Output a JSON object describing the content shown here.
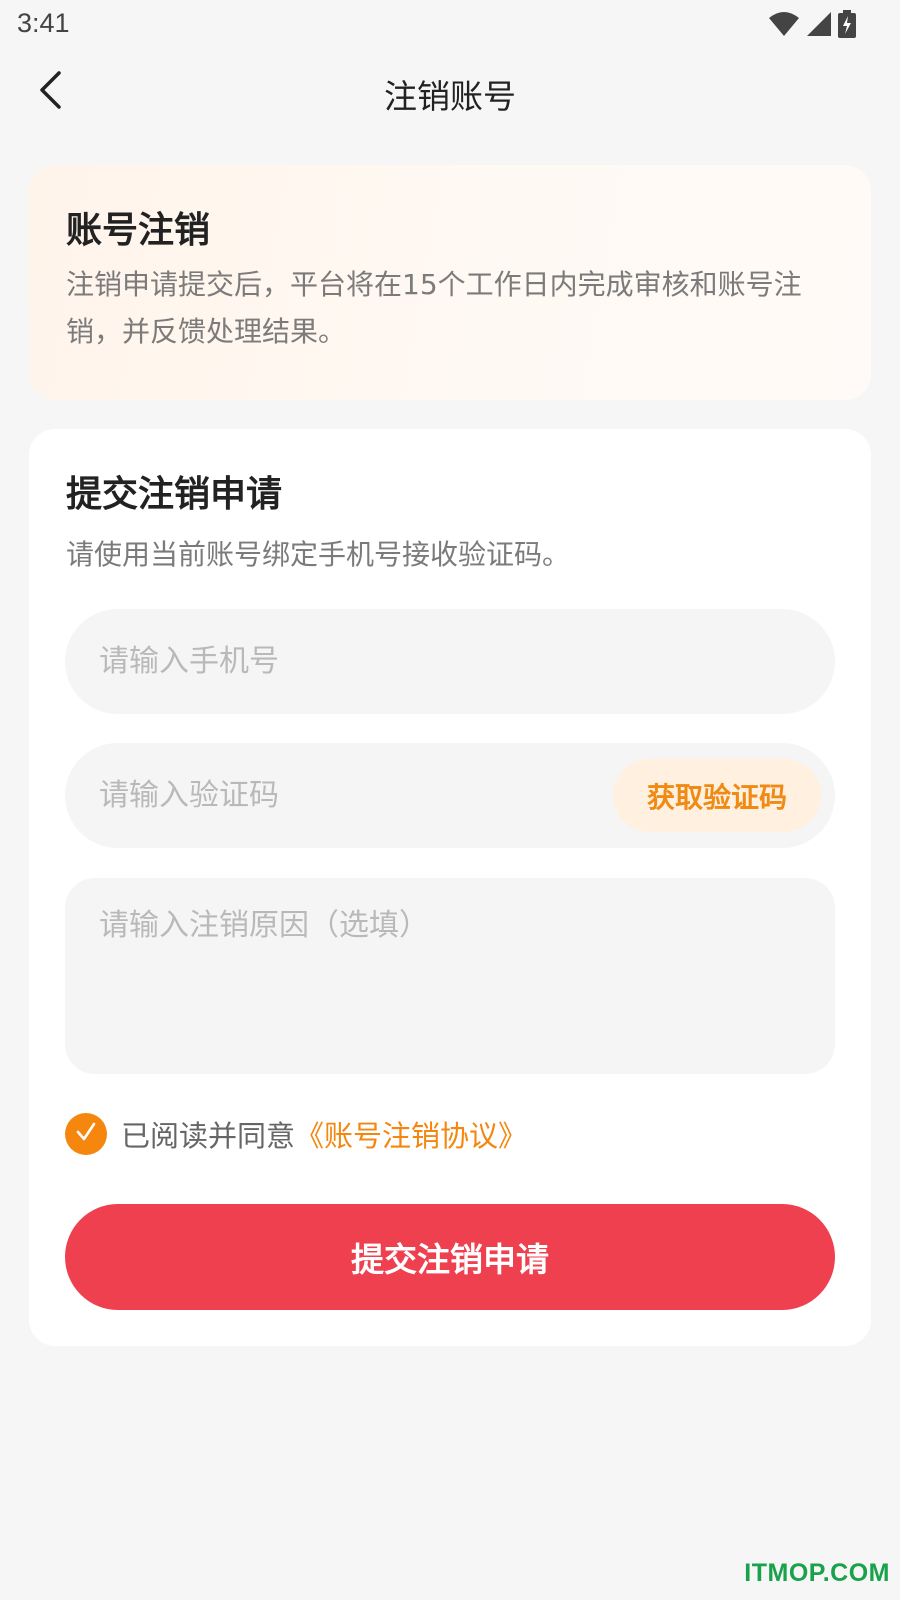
{
  "status_bar": {
    "time": "3:41",
    "icons": [
      "wifi-icon",
      "signal-icon",
      "battery-charging-icon"
    ]
  },
  "nav": {
    "back_icon": "chevron-left-icon",
    "title": "注销账号"
  },
  "notice": {
    "title": "账号注销",
    "text": "注销申请提交后，平台将在15个工作日内完成审核和账号注销，并反馈处理结果。"
  },
  "form": {
    "title": "提交注销申请",
    "hint": "请使用当前账号绑定手机号接收验证码。",
    "phone_placeholder": "请输入手机号",
    "phone_value": "",
    "code_placeholder": "请输入验证码",
    "code_value": "",
    "get_code_label": "获取验证码",
    "reason_placeholder": "请输入注销原因（选填）",
    "reason_value": "",
    "agree_checked": true,
    "agree_text": "已阅读并同意",
    "agreement_link": "《账号注销协议》",
    "submit_label": "提交注销申请"
  },
  "watermark": "ITMOP.COM",
  "colors": {
    "accent_orange": "#f5870f",
    "submit_red": "#ef4050",
    "background": "#f6f6f6",
    "watermark_green": "#19a24b"
  }
}
